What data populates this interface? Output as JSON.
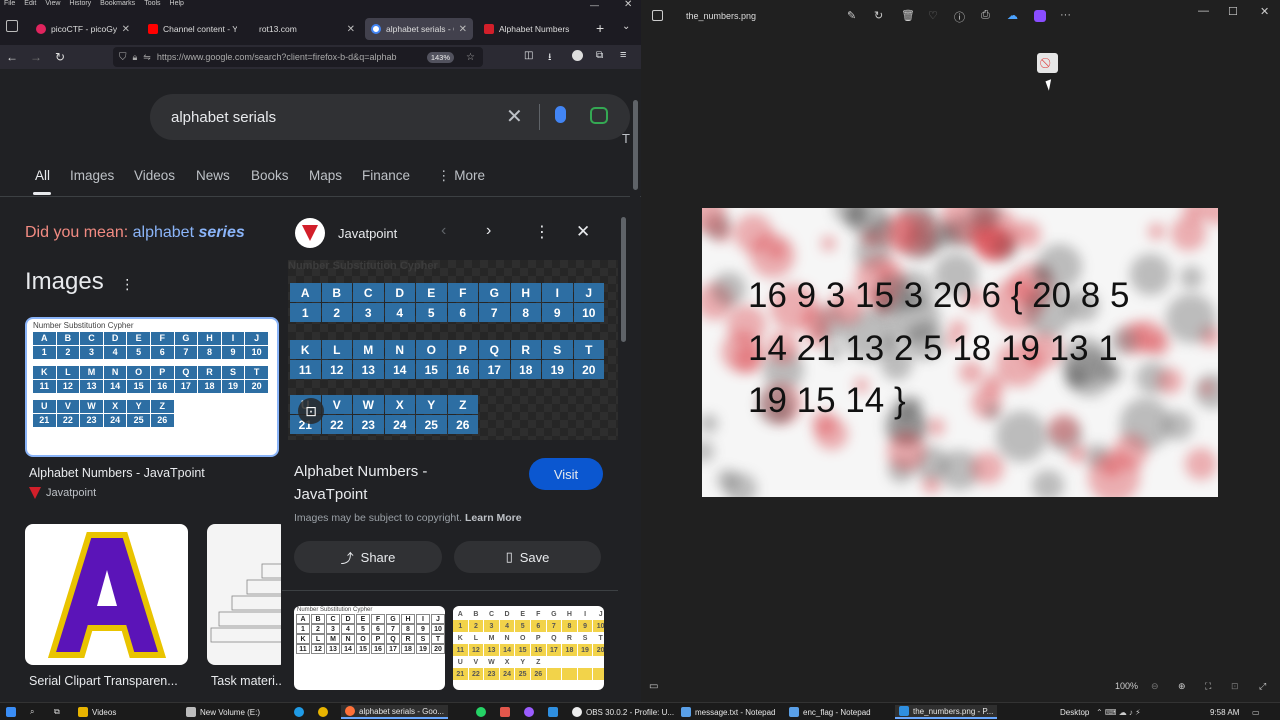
{
  "firefox": {
    "menu": [
      "File",
      "Edit",
      "View",
      "History",
      "Bookmarks",
      "Tools",
      "Help"
    ],
    "tabs": [
      {
        "label": "picoCTF - picoGym C",
        "color": "#e0245e"
      },
      {
        "label": "Channel content - Yo",
        "color": "#ff0000"
      },
      {
        "label": "rot13.com",
        "color": ""
      },
      {
        "label": "alphabet serials - Go",
        "color": "#4285f4"
      },
      {
        "label": "Alphabet Numbers - Ja",
        "color": "#d21f2a"
      }
    ],
    "url": "https://www.google.com/search?client=firefox-b-d&q=alphab",
    "zoom": "143%"
  },
  "google": {
    "query": "alphabet serials",
    "tabs": [
      "All",
      "Images",
      "Videos",
      "News",
      "Books",
      "Maps",
      "Finance",
      "More"
    ],
    "did_you_mean_label": "Did you mean:",
    "did_you_mean_word": "alphabet",
    "did_you_mean_bold": "series",
    "images_heading": "Images",
    "results": [
      {
        "title": "Alphabet Numbers - JavaTpoint",
        "source": "Javatpoint"
      },
      {
        "title": "Serial Clipart Transparen...",
        "source": ""
      },
      {
        "title": "Task materi...",
        "source": ""
      }
    ],
    "card_heading": "Number Substitution Cypher"
  },
  "panel": {
    "source": "Javatpoint",
    "heading": "Number Substitution Cypher",
    "title_line1": "Alphabet Numbers -",
    "title_line2": "JavaTpoint",
    "visit": "Visit",
    "copyright": "Images may be subject to copyright.",
    "learn_more": "Learn More",
    "share": "Share",
    "save": "Save"
  },
  "cypher": {
    "row1_letters": [
      "A",
      "B",
      "C",
      "D",
      "E",
      "F",
      "G",
      "H",
      "I",
      "J"
    ],
    "row1_numbers": [
      "1",
      "2",
      "3",
      "4",
      "5",
      "6",
      "7",
      "8",
      "9",
      "10"
    ],
    "row2_letters": [
      "K",
      "L",
      "M",
      "N",
      "O",
      "P",
      "Q",
      "R",
      "S",
      "T"
    ],
    "row2_numbers": [
      "11",
      "12",
      "13",
      "14",
      "15",
      "16",
      "17",
      "18",
      "19",
      "20"
    ],
    "row3_letters": [
      "U",
      "V",
      "W",
      "X",
      "Y",
      "Z"
    ],
    "row3_numbers": [
      "21",
      "22",
      "23",
      "24",
      "25",
      "26"
    ]
  },
  "photos": {
    "filename": "the_numbers.png",
    "image_text": "16 9 3 15 3 20 6 { 20 8 5\n14 21 13 2 5 18 19 13 1\n19 15 14 }",
    "zoom": "100%"
  },
  "taskbar": {
    "items": [
      {
        "label": "Videos"
      },
      {
        "label": "New Volume (E:)"
      },
      {
        "label": "alphabet serials - Goo..."
      },
      {
        "label": "OBS 30.0.2 - Profile: U..."
      },
      {
        "label": "message.txt - Notepad"
      },
      {
        "label": "enc_flag - Notepad"
      },
      {
        "label": "the_numbers.png - P..."
      }
    ],
    "desktop": "Desktop",
    "time": "9:58 AM"
  }
}
